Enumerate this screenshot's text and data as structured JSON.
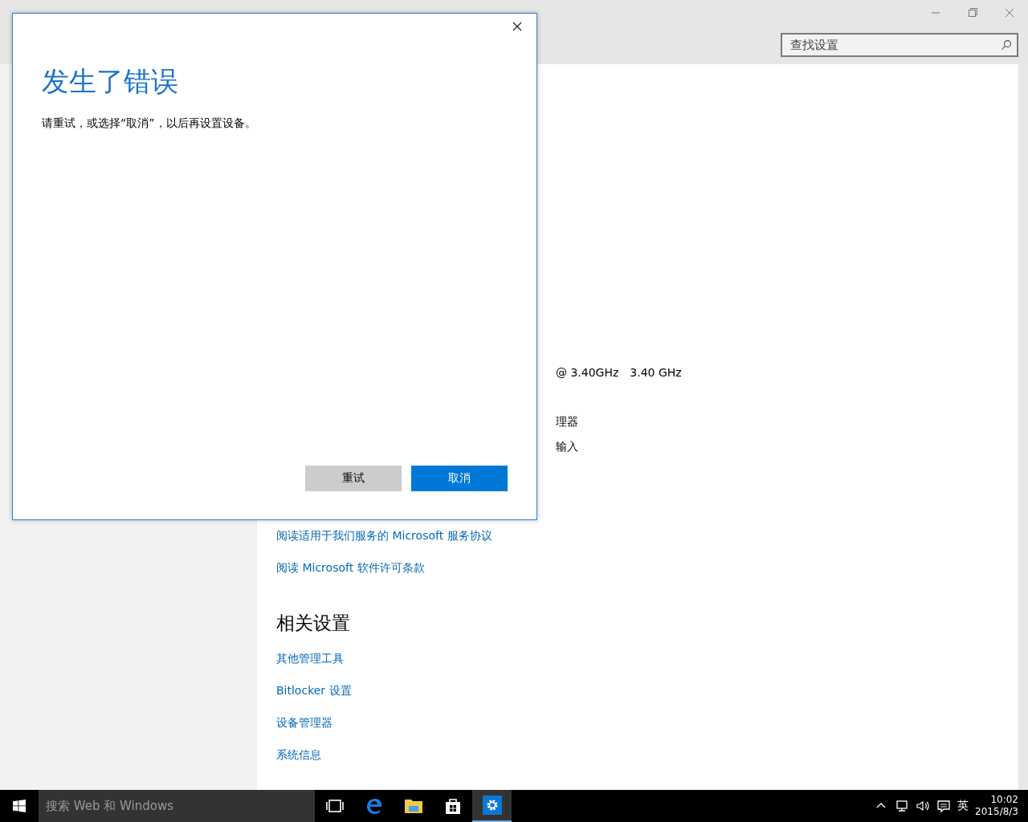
{
  "window": {
    "search": {
      "placeholder": "查找设置"
    }
  },
  "content": {
    "fragments": [
      {
        "texts": [
          "@ 3.40GHz",
          "3.40 GHz"
        ]
      },
      {
        "texts": [
          "理器"
        ]
      },
      {
        "texts": [
          "输入"
        ]
      }
    ],
    "links": [
      "阅读适用于我们服务的 Microsoft 服务协议",
      "阅读 Microsoft 软件许可条款"
    ],
    "related": {
      "heading": "相关设置",
      "links": [
        "其他管理工具",
        "Bitlocker 设置",
        "设备管理器",
        "系统信息"
      ]
    }
  },
  "dialog": {
    "title": "发生了错误",
    "message": "请重试，或选择“取消”，以后再设置设备。",
    "buttons": [
      {
        "label": "重试",
        "kind": "secondary"
      },
      {
        "label": "取消",
        "kind": "primary"
      }
    ]
  },
  "taskbar": {
    "search_placeholder": "搜索 Web 和 Windows",
    "apps": [
      {
        "kind": "task-view",
        "selected": false
      },
      {
        "kind": "browser",
        "selected": false
      },
      {
        "kind": "folder",
        "selected": false
      },
      {
        "kind": "store",
        "selected": false
      },
      {
        "kind": "settings",
        "selected": true
      }
    ],
    "tray": {
      "language": "英",
      "time": "10:02",
      "date": "2015/8/3"
    }
  }
}
